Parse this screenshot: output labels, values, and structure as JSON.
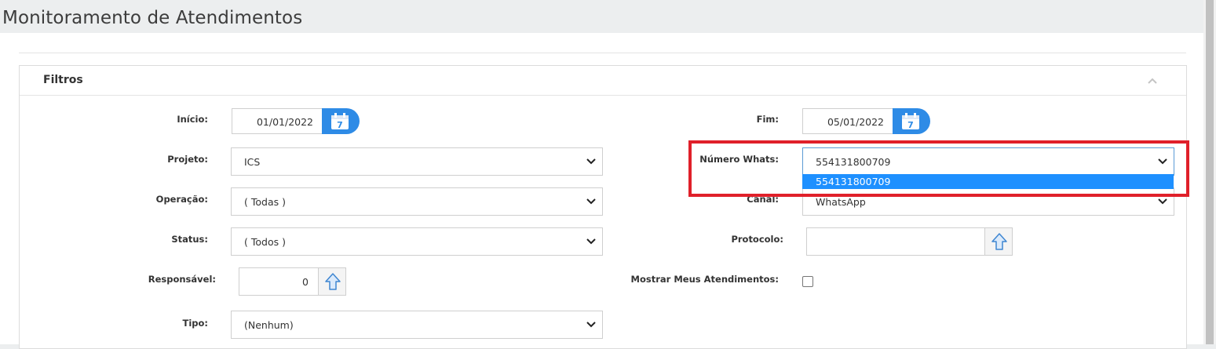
{
  "page": {
    "title": "Monitoramento de Atendimentos"
  },
  "filters": {
    "title": "Filtros",
    "inicio": {
      "label": "Início:",
      "value": "01/01/2022"
    },
    "fim": {
      "label": "Fim:",
      "value": "05/01/2022"
    },
    "projeto": {
      "label": "Projeto:",
      "value": "ICS"
    },
    "numero_whats": {
      "label": "Número Whats:",
      "value": "554131800709",
      "options": [
        "554131800709"
      ]
    },
    "operacao": {
      "label": "Operação:",
      "value": "( Todas )"
    },
    "canal": {
      "label": "Canal:",
      "value": "WhatsApp"
    },
    "status": {
      "label": "Status:",
      "value": "( Todos )"
    },
    "protocolo": {
      "label": "Protocolo:",
      "value": ""
    },
    "responsavel": {
      "label": "Responsável:",
      "value": "0"
    },
    "mostrar_meus": {
      "label": "Mostrar Meus Atendimentos:",
      "checked": false
    },
    "tipo": {
      "label": "Tipo:",
      "value": "(Nenhum)"
    }
  },
  "colors": {
    "accent": "#2e8be6",
    "highlight": "#e0202a",
    "selected_option": "#1e90ff"
  },
  "icons": [
    "calendar-icon",
    "chevron-down-icon",
    "chevron-up-icon",
    "arrow-up-icon"
  ]
}
